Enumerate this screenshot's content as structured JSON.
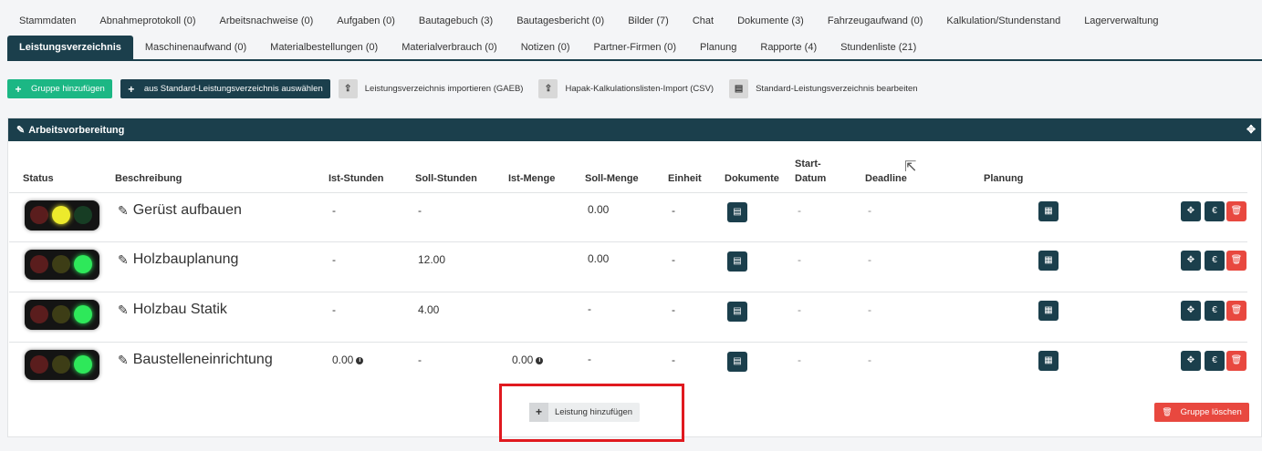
{
  "tabs_row1": [
    "Stammdaten",
    "Abnahmeprotokoll (0)",
    "Arbeitsnachweise (0)",
    "Aufgaben (0)",
    "Bautagebuch (3)",
    "Bautagesbericht (0)",
    "Bilder (7)",
    "Chat",
    "Dokumente (3)",
    "Fahrzeugaufwand (0)",
    "Kalkulation/Stundenstand",
    "Lagerverwaltung"
  ],
  "tabs_row2": [
    "Leistungsverzeichnis",
    "Maschinenaufwand (0)",
    "Materialbestellungen (0)",
    "Materialverbrauch (0)",
    "Notizen (0)",
    "Partner-Firmen (0)",
    "Planung",
    "Rapporte (4)",
    "Stundenliste (21)"
  ],
  "active_tab": "Leistungsverzeichnis",
  "toolbar": {
    "add_group": "Gruppe hinzufügen",
    "from_standard": "aus Standard-Leistungsverzeichnis auswählen",
    "import_gaeb": "Leistungsverzeichnis importieren (GAEB)",
    "import_hapak": "Hapak-Kalkulationslisten-Import (CSV)",
    "edit_standard": "Standard-Leistungsverzeichnis bearbeiten"
  },
  "panel": {
    "title": "Arbeitsvorbereitung",
    "add_service": "Leistung hinzufügen",
    "delete_group": "Gruppe löschen"
  },
  "columns": {
    "status": "Status",
    "beschreibung": "Beschreibung",
    "ist_stunden": "Ist-Stunden",
    "soll_stunden": "Soll-Stunden",
    "ist_menge": "Ist-Menge",
    "soll_menge": "Soll-Menge",
    "einheit": "Einheit",
    "dokumente": "Dokumente",
    "start_datum_1": "Start-",
    "start_datum_2": "Datum",
    "deadline": "Deadline",
    "planung": "Planung"
  },
  "rows": [
    {
      "status": "yellow",
      "beschreibung": "Gerüst aufbauen",
      "ist_stunden": "-",
      "soll_stunden": "-",
      "ist_menge": "",
      "soll_menge": "0.00",
      "einheit": "-",
      "start": "-",
      "deadline": "-"
    },
    {
      "status": "green",
      "beschreibung": "Holzbauplanung",
      "ist_stunden": "-",
      "soll_stunden": "12.00",
      "ist_menge": "",
      "soll_menge": "0.00",
      "einheit": "-",
      "start": "-",
      "deadline": "-"
    },
    {
      "status": "green",
      "beschreibung": "Holzbau Statik",
      "ist_stunden": "-",
      "soll_stunden": "4.00",
      "ist_menge": "",
      "soll_menge": "-",
      "einheit": "-",
      "start": "-",
      "deadline": "-"
    },
    {
      "status": "green",
      "beschreibung": "Baustelleneinrichtung",
      "ist_stunden": "0.00",
      "soll_stunden": "-",
      "ist_menge": "0.00",
      "soll_menge": "-",
      "einheit": "-",
      "start": "-",
      "deadline": "-"
    }
  ],
  "colors": {
    "primary": "#1b3f4c",
    "success": "#1cb784",
    "danger": "#e8483f",
    "highlight": "#e0191f"
  }
}
